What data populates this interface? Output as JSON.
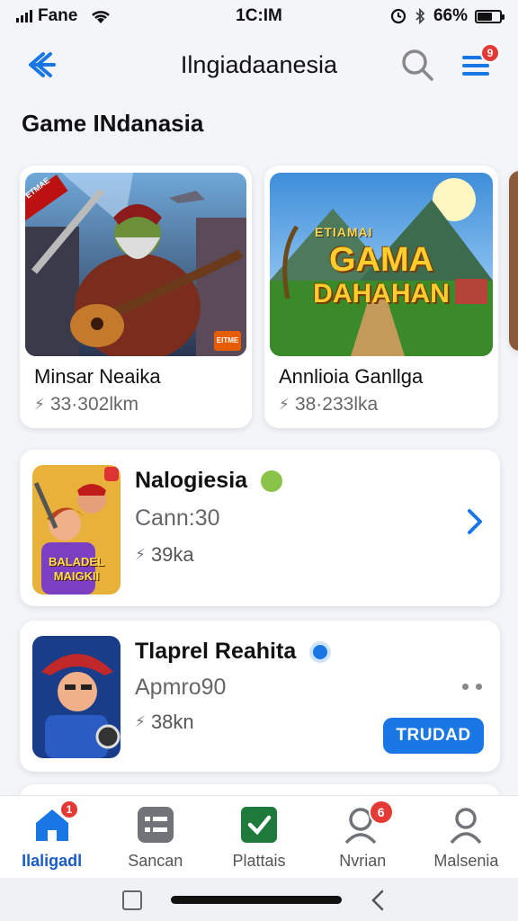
{
  "status": {
    "carrier": "Fane",
    "time": "1C:IM",
    "battery": "66%",
    "battery_level": 0.66
  },
  "header": {
    "title": "Ilngiadaanesia",
    "menu_badge": "9"
  },
  "section": {
    "title": "Game INdanasia"
  },
  "cards": [
    {
      "title": "Minsar Neaika",
      "meta": "33·302lkm",
      "art_banner": "ETMAE",
      "art_badge": "EITME",
      "icon": "bolt-icon"
    },
    {
      "title": "Annlioia Ganllga",
      "meta": "38·233lka",
      "art_text_small": "ETIAMAI",
      "art_text_1": "GAMA",
      "art_text_2": "DAHAHAN",
      "icon": "bolt-icon"
    }
  ],
  "list": [
    {
      "title": "Nalogiesia",
      "subtitle": "Cann:30",
      "meta": "39ka",
      "art_text_1": "BALADEL",
      "art_text_2": "MAIGKII",
      "action_icon": "chevron-right-icon"
    },
    {
      "title": "Tlaprel Reahita",
      "subtitle": "Apmro90",
      "meta": "38kn",
      "button": "TRUDAD",
      "action_icon": "more-dots-icon"
    }
  ],
  "bottom_nav": [
    {
      "label": "Ilaligadl",
      "icon": "home-icon",
      "badge": "1",
      "active": true
    },
    {
      "label": "Sancan",
      "icon": "list-icon"
    },
    {
      "label": "Plattais",
      "icon": "check-icon"
    },
    {
      "label": "Nvrian",
      "icon": "user-search-icon",
      "badge": "6"
    },
    {
      "label": "Malsenia",
      "icon": "profile-icon"
    }
  ],
  "colors": {
    "accent": "#1877e5",
    "badge": "#e53935",
    "background": "#f3f5f9"
  }
}
